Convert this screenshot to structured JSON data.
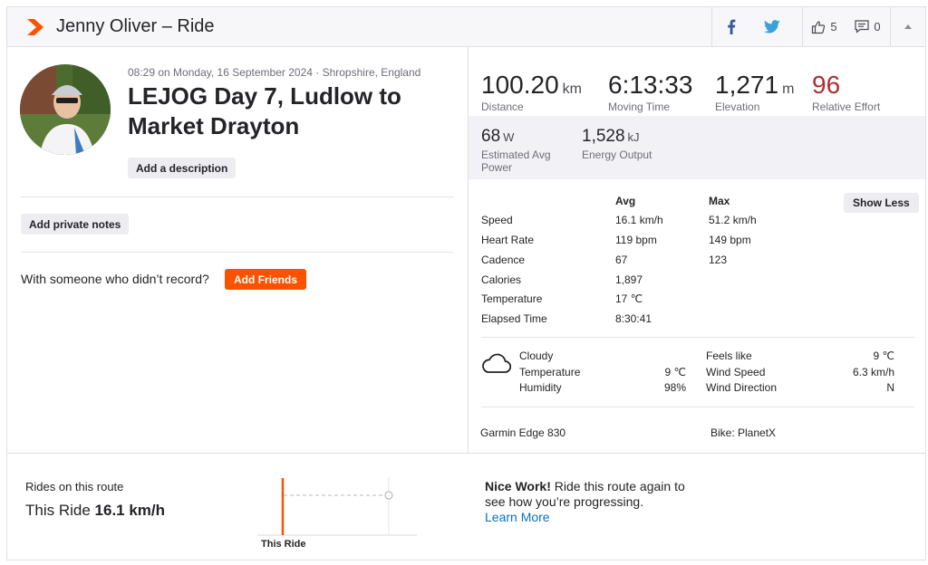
{
  "header": {
    "title": "Jenny Oliver – Ride",
    "kudos_count": "5",
    "comment_count": "0",
    "icons": [
      "strava-logo-icon",
      "facebook-icon",
      "twitter-icon",
      "thumbs-up-icon",
      "comment-icon",
      "chevron-up-icon"
    ],
    "accent": "#fc5200"
  },
  "activity": {
    "meta": "08:29 on Monday, 16 September 2024 · Shropshire, England",
    "title": "LEJOG Day 7, Ludlow to Market Drayton",
    "add_description": "Add a description",
    "add_private_notes": "Add private notes",
    "with_someone": "With someone who didn’t record?",
    "add_friends": "Add Friends"
  },
  "stats": {
    "distance": {
      "value": "100.20",
      "unit": "km",
      "label": "Distance"
    },
    "moving_time": {
      "value": "6:13:33",
      "label": "Moving Time"
    },
    "elevation": {
      "value": "1,271",
      "unit": "m",
      "label": "Elevation"
    },
    "relative_effort": {
      "value": "96",
      "label": "Relative Effort",
      "color": "#b02e2e"
    },
    "power": {
      "value": "68",
      "unit": "W",
      "label": "Estimated Avg Power"
    },
    "energy": {
      "value": "1,528",
      "unit": "kJ",
      "label": "Energy Output"
    }
  },
  "details": {
    "col_avg": "Avg",
    "col_max": "Max",
    "show_less": "Show Less",
    "rows": [
      {
        "label": "Speed",
        "avg": "16.1 km/h",
        "max": "51.2 km/h"
      },
      {
        "label": "Heart Rate",
        "avg": "119 bpm",
        "max": "149 bpm"
      },
      {
        "label": "Cadence",
        "avg": "67",
        "max": "123"
      },
      {
        "label": "Calories",
        "avg": "1,897",
        "max": ""
      },
      {
        "label": "Temperature",
        "avg": "17 ℃",
        "max": ""
      },
      {
        "label": "Elapsed Time",
        "avg": "8:30:41",
        "max": ""
      }
    ]
  },
  "weather": {
    "condition": "Cloudy",
    "temperature_label": "Temperature",
    "temperature": "9 ℃",
    "humidity_label": "Humidity",
    "humidity": "98%",
    "feels_like_label": "Feels like",
    "feels_like": "9 ℃",
    "wind_speed_label": "Wind Speed",
    "wind_speed": "6.3 km/h",
    "wind_direction_label": "Wind Direction",
    "wind_direction": "N"
  },
  "gear": {
    "device": "Garmin Edge 830",
    "bike": "Bike: PlanetX"
  },
  "route": {
    "label": "Rides on this route",
    "this_ride_prefix": "This Ride",
    "this_ride_value": "16.1 km/h",
    "bar_label": "This Ride",
    "nice_bold": "Nice Work!",
    "nice_text": " Ride this route again to see how you’re progressing.",
    "learn_more": "Learn More"
  }
}
